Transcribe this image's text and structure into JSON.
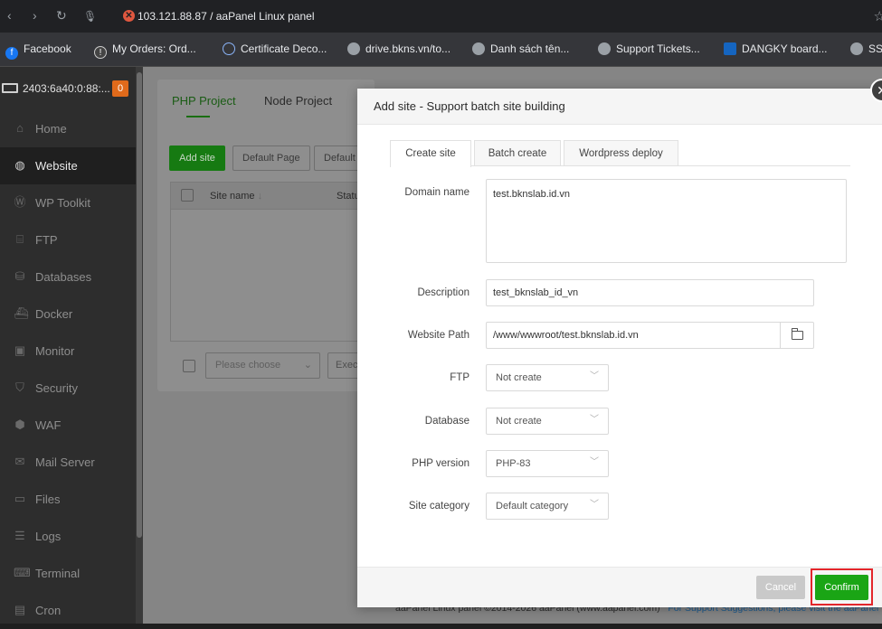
{
  "browser": {
    "url": "103.121.88.87 / aaPanel Linux panel",
    "bookmarks": [
      {
        "label": "Facebook",
        "icon": "facebook-icon"
      },
      {
        "label": "My Orders: Ord...",
        "icon": "orders-icon"
      },
      {
        "label": "Certificate Deco...",
        "icon": "certificate-icon"
      },
      {
        "label": "drive.bkns.vn/to...",
        "icon": "globe-icon"
      },
      {
        "label": "Danh sách tên...",
        "icon": "globe-icon"
      },
      {
        "label": "Support Tickets...",
        "icon": "globe-icon"
      },
      {
        "label": "DANGKY board...",
        "icon": "dangky-icon"
      },
      {
        "label": "SS",
        "icon": "globe-icon"
      }
    ]
  },
  "sidebar": {
    "server": "2403:6a40:0:88:...",
    "badge": "0",
    "items": [
      {
        "label": "Home",
        "icon": "home-icon"
      },
      {
        "label": "Website",
        "icon": "globe-icon"
      },
      {
        "label": "WP Toolkit",
        "icon": "wordpress-icon"
      },
      {
        "label": "FTP",
        "icon": "ftp-icon"
      },
      {
        "label": "Databases",
        "icon": "database-icon"
      },
      {
        "label": "Docker",
        "icon": "docker-icon"
      },
      {
        "label": "Monitor",
        "icon": "monitor-icon"
      },
      {
        "label": "Security",
        "icon": "shield-icon"
      },
      {
        "label": "WAF",
        "icon": "waf-icon"
      },
      {
        "label": "Mail Server",
        "icon": "mail-icon"
      },
      {
        "label": "Files",
        "icon": "folder-icon"
      },
      {
        "label": "Logs",
        "icon": "logs-icon"
      },
      {
        "label": "Terminal",
        "icon": "terminal-icon"
      },
      {
        "label": "Cron",
        "icon": "cron-icon"
      }
    ]
  },
  "main": {
    "tabs": [
      "PHP Project",
      "Node Project"
    ],
    "add_site": "Add site",
    "default_page": "Default Page",
    "default_trunc": "Default",
    "col_site": "Site name",
    "col_status": "Statu",
    "select_placeholder": "Please choose",
    "exec": "Exec",
    "copyright": "aaPanel Linux panel ©2014-2026 aaPanel (www.aapanel.com)",
    "support": "For Support Suggestions, please visit the aaPanel"
  },
  "modal": {
    "title": "Add site - Support batch site building",
    "tabs": [
      "Create site",
      "Batch create",
      "Wordpress deploy"
    ],
    "fields": {
      "domain_label": "Domain name",
      "domain_value": "test.bknslab.id.vn",
      "description_label": "Description",
      "description_value": "test_bknslab_id_vn",
      "path_label": "Website Path",
      "path_value": "/www/wwwroot/test.bknslab.id.vn",
      "ftp_label": "FTP",
      "ftp_value": "Not create",
      "db_label": "Database",
      "db_value": "Not create",
      "php_label": "PHP version",
      "php_value": "PHP-83",
      "category_label": "Site category",
      "category_value": "Default category"
    },
    "cancel": "Cancel",
    "confirm": "Confirm"
  }
}
